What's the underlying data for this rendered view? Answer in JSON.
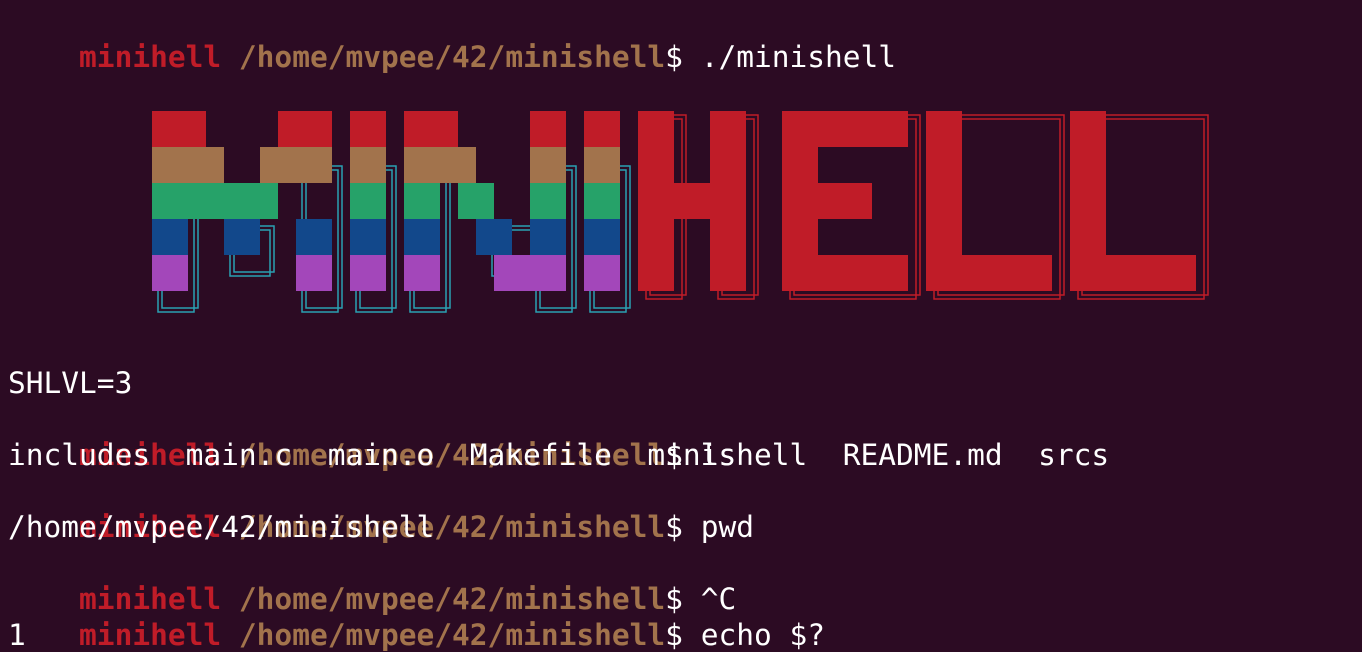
{
  "terminal": {
    "prompt": {
      "user": "minihell",
      "path": "/home/mvpee/42/minishell",
      "symbol": "$"
    },
    "lines": [
      {
        "type": "prompt",
        "cmd": " ./minishell"
      },
      {
        "type": "output",
        "text": "SHLVL=3"
      },
      {
        "type": "prompt",
        "cmd": " ls"
      },
      {
        "type": "output",
        "text": "includes  main.c  main.o  Makefile  minishell  README.md  srcs"
      },
      {
        "type": "prompt",
        "cmd": " pwd"
      },
      {
        "type": "output",
        "text": "/home/mvpee/42/minishell"
      },
      {
        "type": "prompt",
        "cmd": " ^C"
      },
      {
        "type": "prompt",
        "cmd": " echo $?"
      },
      {
        "type": "output",
        "text": "1"
      }
    ],
    "banner": {
      "text": "MINIHELL",
      "colors": {
        "red": "#c01c28",
        "brown": "#a2734c",
        "green": "#26a269",
        "blue": "#12488b",
        "purple": "#a347ba",
        "cyan": "#2aa1b3",
        "background": "#2c0b23"
      }
    }
  }
}
